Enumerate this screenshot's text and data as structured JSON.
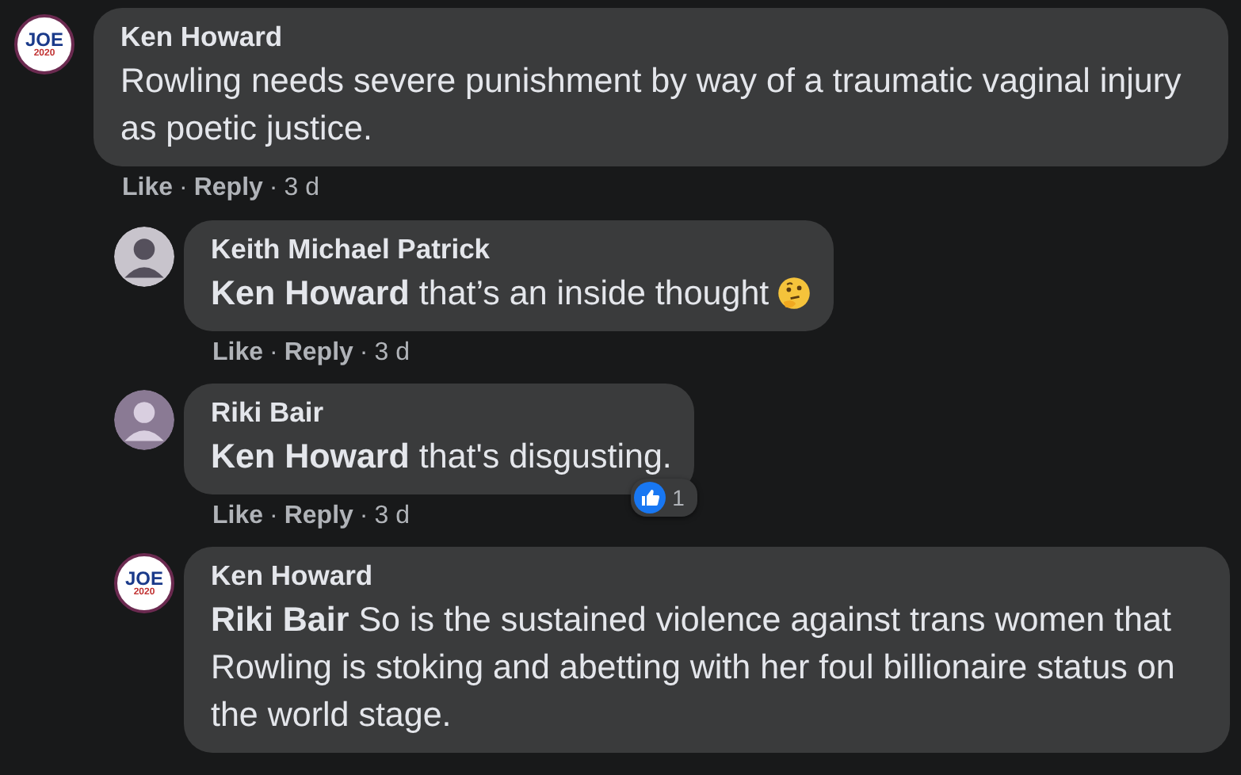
{
  "comments": [
    {
      "kind": "comment",
      "author": "Ken Howard",
      "avatar": {
        "kind": "logo",
        "text": "JOE",
        "subtext": "2020"
      },
      "text": "Rowling needs severe punishment by way of a traumatic vaginal injury as poetic justice.",
      "actions": [
        "Like",
        "Reply"
      ],
      "separator": "·",
      "time": "3 d"
    },
    {
      "kind": "reply",
      "author": "Keith Michael Patrick",
      "avatar": {
        "kind": "photo"
      },
      "text": "**Ken Howard** that’s an inside thought",
      "inline_icon": {
        "kind": "thinking"
      },
      "actions": [
        "Like",
        "Reply"
      ],
      "separator": "·",
      "time": "3 d"
    },
    {
      "kind": "reply",
      "author": "Riki Bair",
      "avatar": {
        "kind": "photo"
      },
      "text": "**Ken Howard** that's disgusting.",
      "reaction_count": "1",
      "actions": [
        "Like",
        "Reply"
      ],
      "separator": "·",
      "time": "3 d"
    },
    {
      "kind": "reply",
      "author": "Ken Howard",
      "avatar": {
        "kind": "logo",
        "text": "JOE",
        "subtext": "2020"
      },
      "text": "**Riki Bair** So is the sustained violence against trans women that Rowling is stoking and abetting with her foul billionaire status on the world stage."
    }
  ]
}
